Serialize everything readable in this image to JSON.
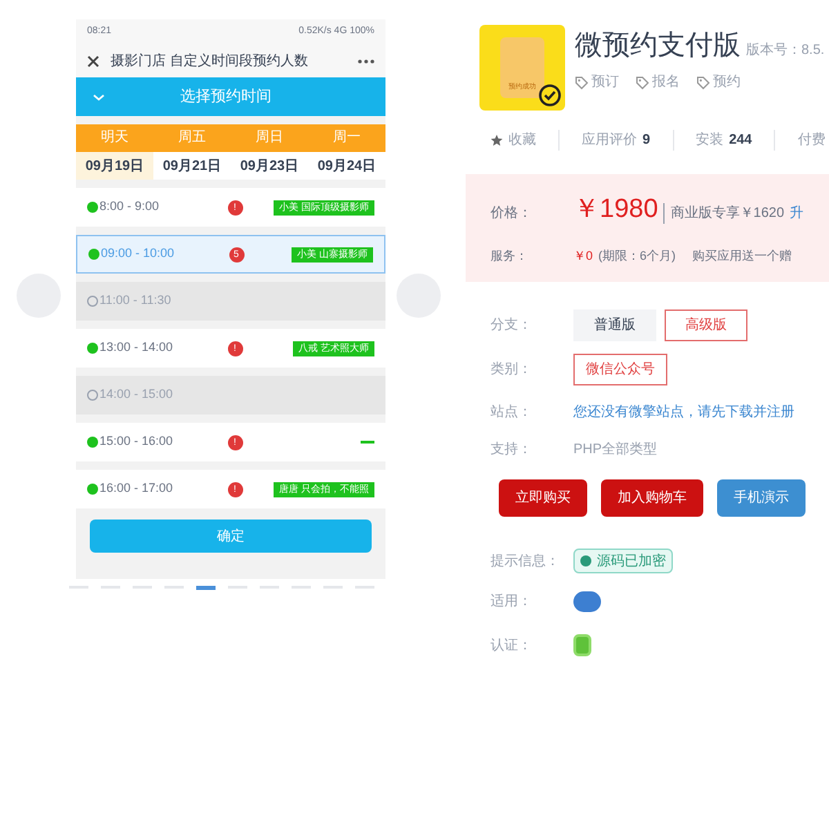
{
  "phone": {
    "status_time": "08:21",
    "status_right": "0.52K/s 4G 100%",
    "title": "摄影门店 自定义时间段预约人数",
    "picker_title": "选择预约时间",
    "days": [
      {
        "weekday": "明天",
        "date": "09月19日",
        "selected": true
      },
      {
        "weekday": "周五",
        "date": "09月21日",
        "selected": false
      },
      {
        "weekday": "周日",
        "date": "09月23日",
        "selected": false
      },
      {
        "weekday": "周一",
        "date": "09月24日",
        "selected": false
      }
    ],
    "slots": [
      {
        "kind": "available",
        "time": "8:00 - 9:00",
        "selected": false,
        "badge": "!",
        "tag": "小美 国际顶级摄影师"
      },
      {
        "kind": "available",
        "time": "09:00 - 10:00",
        "selected": true,
        "badge": "5",
        "tag": "小美 山寨摄影师"
      },
      {
        "kind": "full",
        "time": "11:00 - 11:30",
        "selected": false
      },
      {
        "kind": "available",
        "time": "13:00 - 14:00",
        "selected": false,
        "badge": "!",
        "tag": "八戒 艺术照大师"
      },
      {
        "kind": "full",
        "time": "14:00 - 15:00",
        "selected": false
      },
      {
        "kind": "available",
        "time": "15:00 - 16:00",
        "selected": false,
        "badge": "!"
      },
      {
        "kind": "available",
        "time": "16:00 - 17:00",
        "selected": false,
        "badge": "!",
        "tag": "唐唐 只会拍，不能照"
      }
    ],
    "confirm": "确定"
  },
  "carousel": {
    "pages": [
      {
        "selected": false
      },
      {
        "selected": false
      },
      {
        "selected": false
      },
      {
        "selected": false
      },
      {
        "selected": true
      },
      {
        "selected": false
      },
      {
        "selected": false
      },
      {
        "selected": false
      },
      {
        "selected": false
      },
      {
        "selected": false
      }
    ]
  },
  "product": {
    "icon_label": "预约成功",
    "name": "微预约支付版",
    "version": "版本号：8.5.",
    "tags": [
      "预订",
      "报名",
      "预约"
    ],
    "stats": [
      {
        "kind": "favorite",
        "label": "收藏"
      },
      {
        "kind": "count",
        "label": "应用评价",
        "value": "9"
      },
      {
        "kind": "count",
        "label": "安装",
        "value": "244"
      },
      {
        "kind": "count",
        "label": "付费"
      }
    ],
    "price_label": "价格：",
    "price": "￥1980",
    "price_note": "商业版专享￥1620",
    "price_link": "升",
    "service_label": "服务：",
    "service_price": "￥0",
    "service_note": "(期限：6个月)",
    "service_extra": "购买应用送一个赠",
    "branch_label": "分支：",
    "branches": [
      {
        "label": "普通版",
        "selected": false
      },
      {
        "label": "高级版",
        "selected": true
      }
    ],
    "category_label": "类别：",
    "category": "微信公众号",
    "site_label": "站点：",
    "site_text": "您还没有微擎站点，请先下载并注册",
    "support_label": "支持：",
    "support_text": "PHP全部类型",
    "buttons": [
      {
        "kind": "primary",
        "label": "立即购买"
      },
      {
        "kind": "primary",
        "label": "加入购物车"
      },
      {
        "kind": "secondary",
        "label": "手机演示"
      }
    ],
    "hint_label": "提示信息：",
    "hint": "源码已加密",
    "apply_label": "适用：",
    "cert_label": "认证："
  }
}
